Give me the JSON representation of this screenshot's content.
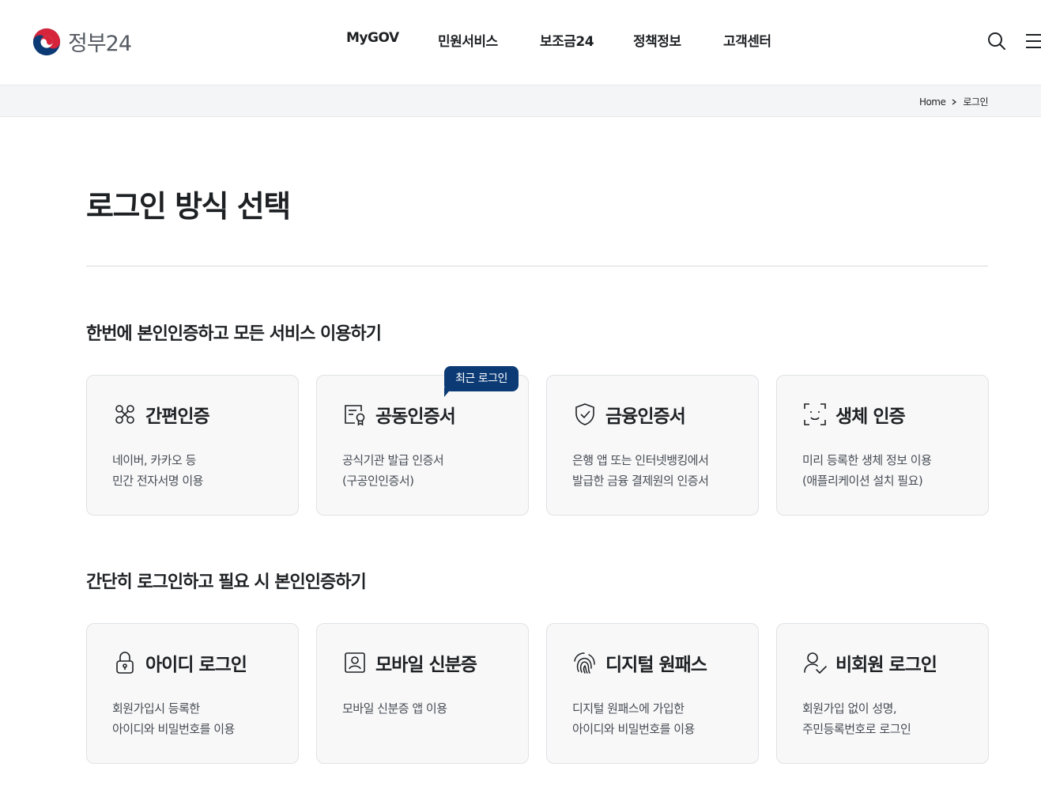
{
  "header": {
    "logo_text": "정부24",
    "nav": [
      "MyGOV",
      "민원서비스",
      "보조금24",
      "정책정보",
      "고객센터"
    ],
    "icons": [
      "search-icon",
      "menu-icon"
    ]
  },
  "breadcrumb": {
    "home": "Home",
    "current": "로그인"
  },
  "page": {
    "title": "로그인 방식 선택"
  },
  "section1": {
    "title": "한번에 본인인증하고 모든 서비스 이용하기",
    "badge": "최근 로그인",
    "cards": [
      {
        "icon": "simple-auth-icon",
        "title": "간편인증",
        "desc": [
          "네이버, 카카오 등",
          "민간 전자서명 이용"
        ]
      },
      {
        "icon": "certificate-icon",
        "title": "공동인증서",
        "desc": [
          "공식기관 발급 인증서",
          "(구공인인증서)"
        ]
      },
      {
        "icon": "shield-check-icon",
        "title": "금융인증서",
        "desc": [
          "은행 앱 또는 인터넷뱅킹에서",
          "발급한 금융 결제원의 인증서"
        ]
      },
      {
        "icon": "face-scan-icon",
        "title": "생체 인증",
        "desc": [
          "미리 등록한 생체 정보 이용",
          "(애플리케이션 설치 필요)"
        ]
      }
    ]
  },
  "section2": {
    "title": "간단히 로그인하고 필요 시 본인인증하기",
    "cards": [
      {
        "icon": "lock-icon",
        "title": "아이디 로그인",
        "desc": [
          "회원가입시 등록한",
          "아이디와 비밀번호를 이용"
        ]
      },
      {
        "icon": "id-card-icon",
        "title": "모바일 신분증",
        "desc": [
          "모바일 신분증 앱 이용"
        ]
      },
      {
        "icon": "fingerprint-icon",
        "title": "디지털 원패스",
        "desc": [
          "디지털 원패스에 가입한",
          "아이디와 비밀번호를 이용"
        ]
      },
      {
        "icon": "user-check-icon",
        "title": "비회원 로그인",
        "desc": [
          "회원가입 없이 성명,",
          "주민등록번호로 로그인"
        ]
      }
    ]
  },
  "colors": {
    "badge": "#0b3a75",
    "card_bg": "#f8f8f9",
    "card_border": "#dfe2e5",
    "crumb_bg": "#f4f5f6"
  }
}
